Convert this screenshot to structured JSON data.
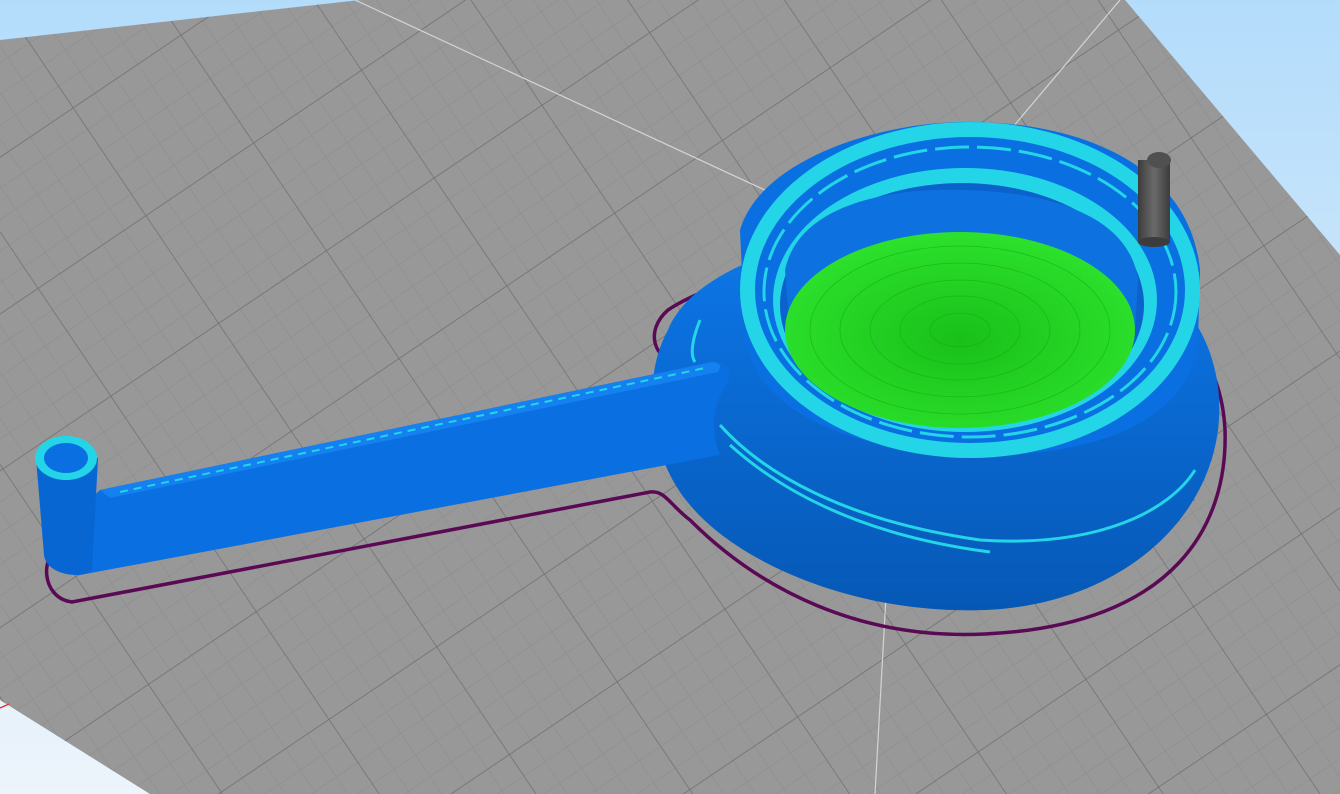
{
  "viewport": {
    "scene": "3d-print-layer-preview",
    "colors": {
      "sky_top": "#b3dcfb",
      "sky_bottom": "#edf4fb",
      "bed": "#989898",
      "bed_grid_minor": "#8b8b8b",
      "bed_grid_major": "#6f6f6f",
      "skirt": "#5a0a55",
      "outer_wall": "#0a6fe0",
      "outer_wall_dark": "#0758b8",
      "inner_wall": "#23d5e6",
      "top_infill": "#1ed61e",
      "tool_pin": "#5a5a5a",
      "axis_line": "#d4d4d4",
      "axis_x": "#e03030"
    },
    "icons": {
      "nozzle": "tool-pin-icon"
    }
  }
}
